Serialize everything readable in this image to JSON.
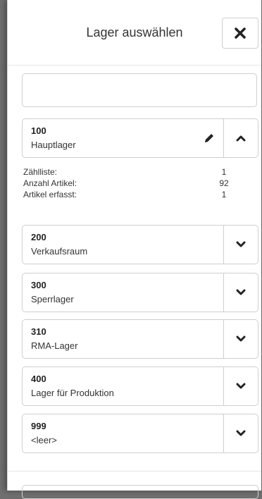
{
  "header": {
    "title": "Lager auswählen",
    "close_icon": "close-icon"
  },
  "search": {
    "value": "",
    "placeholder": ""
  },
  "warehouses": [
    {
      "number": "100",
      "name": "Hauptlager",
      "expanded": true
    },
    {
      "number": "200",
      "name": "Verkaufsraum",
      "expanded": false
    },
    {
      "number": "300",
      "name": "Sperrlager",
      "expanded": false
    },
    {
      "number": "310",
      "name": "RMA-Lager",
      "expanded": false
    },
    {
      "number": "400",
      "name": "Lager für Produktion",
      "expanded": false
    },
    {
      "number": "999",
      "name": "<leer>",
      "expanded": false
    }
  ],
  "details": {
    "count_list_label": "Zählliste:",
    "count_list_value": "1",
    "article_count_label": "Anzahl Artikel:",
    "article_count_value": "92",
    "articles_recorded_label": "Artikel erfasst:",
    "articles_recorded_value": "1"
  },
  "colors": {
    "border": "#cfcfcf",
    "text": "#333333",
    "backdrop": "#6f6f6f"
  }
}
